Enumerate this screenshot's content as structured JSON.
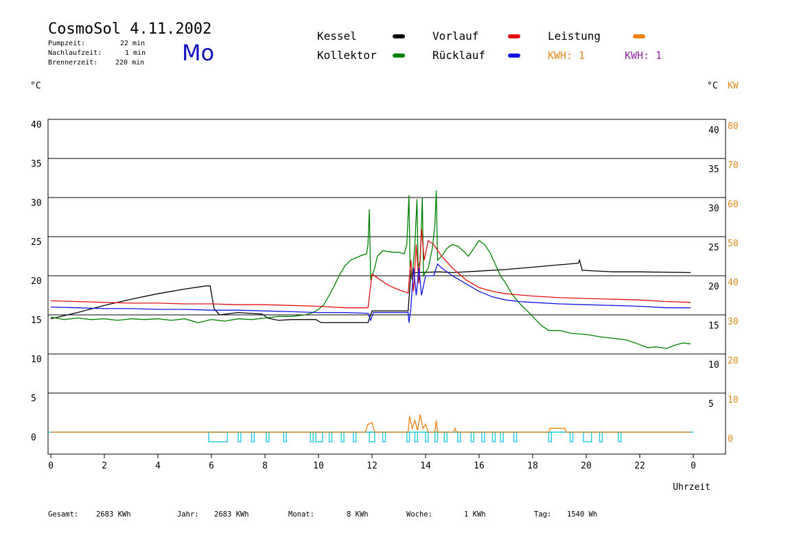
{
  "header": {
    "title": "CosmoSol 4.11.2002",
    "weekday": "Mo",
    "meta": [
      {
        "label": "Pumpzeit:",
        "value": "22 min"
      },
      {
        "label": "Nachlaufzeit:",
        "value": "1 min"
      },
      {
        "label": "Brennerzeit:",
        "value": "220 min"
      }
    ]
  },
  "legend": {
    "items": [
      {
        "name": "Kessel",
        "color": "#000000"
      },
      {
        "name": "Kollektor",
        "color": "#008000"
      },
      {
        "name": "Vorlauf",
        "color": "#e01010"
      },
      {
        "name": "Rücklauf",
        "color": "#1010e0"
      },
      {
        "name": "Leistung",
        "color": "#f08010"
      }
    ],
    "kwh": [
      {
        "text": "KWH: 1",
        "color": "#e08a20"
      },
      {
        "text": "KWH: 1",
        "color": "#8a2a9a"
      }
    ]
  },
  "axes": {
    "left_unit": "°C",
    "right_unit": "°C",
    "right_unit2": "KW",
    "kw_color": "#e08a20",
    "xlabel": "Uhrzeit"
  },
  "footer": [
    {
      "label": "Gesamt:",
      "value": "2683 KWh"
    },
    {
      "label": "Jahr:",
      "value": "2683 KWh"
    },
    {
      "label": "Monat:",
      "value": "8 KWh"
    },
    {
      "label": "Woche:",
      "value": "1 KWh"
    },
    {
      "label": "Tag:",
      "value": "1540 Wh"
    }
  ],
  "chart_data": {
    "type": "line",
    "xlabel": "Uhrzeit",
    "ylabel": "°C",
    "y2label": "KW",
    "xlim": [
      0,
      24
    ],
    "ylim": [
      0,
      40
    ],
    "y2lim": [
      0,
      80
    ],
    "grid": true,
    "x_ticks": [
      "0",
      "2",
      "4",
      "6",
      "8",
      "10",
      "12",
      "14",
      "16",
      "18",
      "20",
      "22",
      "0"
    ],
    "y_ticks": [
      "0",
      "5",
      "10",
      "15",
      "20",
      "25",
      "30",
      "35",
      "40"
    ],
    "y2_ticks": [
      "0",
      "10",
      "20",
      "30",
      "40",
      "50",
      "60",
      "70",
      "80"
    ],
    "series": [
      {
        "name": "Kessel",
        "color": "#000000",
        "points": [
          [
            0,
            14.5
          ],
          [
            1,
            15.3
          ],
          [
            2,
            16.2
          ],
          [
            3,
            17.0
          ],
          [
            4,
            17.7
          ],
          [
            5,
            18.3
          ],
          [
            5.8,
            18.7
          ],
          [
            5.95,
            18.7
          ],
          [
            6.1,
            15.8
          ],
          [
            6.3,
            15.0
          ],
          [
            7,
            15.3
          ],
          [
            7.9,
            15.1
          ],
          [
            8.1,
            14.6
          ],
          [
            8.5,
            14.3
          ],
          [
            9,
            14.4
          ],
          [
            9.9,
            14.4
          ],
          [
            10.1,
            14.0
          ],
          [
            11,
            14.0
          ],
          [
            11.85,
            14.0
          ],
          [
            12,
            15.5
          ],
          [
            12.3,
            15.5
          ],
          [
            13.35,
            15.5
          ],
          [
            13.45,
            20.3
          ],
          [
            13.7,
            20.4
          ],
          [
            14.5,
            20.5
          ],
          [
            15,
            20.4
          ],
          [
            16,
            20.6
          ],
          [
            17,
            20.8
          ],
          [
            18,
            21.1
          ],
          [
            19,
            21.4
          ],
          [
            19.7,
            21.6
          ],
          [
            19.75,
            22.0
          ],
          [
            19.85,
            20.7
          ],
          [
            21,
            20.5
          ],
          [
            22,
            20.5
          ],
          [
            23.9,
            20.4
          ]
        ]
      },
      {
        "name": "Kollektor",
        "color": "#008000",
        "points": [
          [
            0,
            14.7
          ],
          [
            0.5,
            14.4
          ],
          [
            1,
            14.6
          ],
          [
            1.5,
            14.4
          ],
          [
            2,
            14.5
          ],
          [
            2.5,
            14.3
          ],
          [
            3,
            14.5
          ],
          [
            3.5,
            14.4
          ],
          [
            4,
            14.5
          ],
          [
            4.5,
            14.3
          ],
          [
            5,
            14.5
          ],
          [
            5.5,
            14.0
          ],
          [
            6,
            14.4
          ],
          [
            6.5,
            14.2
          ],
          [
            7,
            14.5
          ],
          [
            7.5,
            14.4
          ],
          [
            8,
            14.6
          ],
          [
            8.5,
            14.8
          ],
          [
            9,
            14.8
          ],
          [
            9.5,
            15.0
          ],
          [
            9.8,
            15.3
          ],
          [
            10,
            15.7
          ],
          [
            10.2,
            16.3
          ],
          [
            10.4,
            17.5
          ],
          [
            10.6,
            18.8
          ],
          [
            10.8,
            20.2
          ],
          [
            11,
            21.3
          ],
          [
            11.2,
            22.0
          ],
          [
            11.4,
            22.3
          ],
          [
            11.6,
            22.6
          ],
          [
            11.8,
            22.8
          ],
          [
            11.85,
            24.0
          ],
          [
            11.9,
            28.5
          ],
          [
            11.95,
            19.5
          ],
          [
            12.1,
            21.0
          ],
          [
            12.2,
            22.5
          ],
          [
            12.4,
            23.2
          ],
          [
            12.6,
            23.1
          ],
          [
            12.8,
            23.0
          ],
          [
            13,
            23.0
          ],
          [
            13.2,
            22.8
          ],
          [
            13.3,
            24.0
          ],
          [
            13.38,
            30.3
          ],
          [
            13.42,
            21.0
          ],
          [
            13.5,
            19.5
          ],
          [
            13.6,
            24.0
          ],
          [
            13.68,
            29.8
          ],
          [
            13.72,
            21.0
          ],
          [
            13.8,
            22.0
          ],
          [
            13.88,
            30.0
          ],
          [
            13.92,
            20.0
          ],
          [
            14.1,
            21.0
          ],
          [
            14.25,
            23.5
          ],
          [
            14.35,
            26.5
          ],
          [
            14.4,
            30.9
          ],
          [
            14.45,
            22.0
          ],
          [
            14.6,
            22.5
          ],
          [
            14.8,
            23.5
          ],
          [
            15,
            24.0
          ],
          [
            15.2,
            23.8
          ],
          [
            15.4,
            23.2
          ],
          [
            15.6,
            22.5
          ],
          [
            15.8,
            23.5
          ],
          [
            16,
            24.5
          ],
          [
            16.2,
            24.0
          ],
          [
            16.4,
            23.0
          ],
          [
            16.6,
            21.5
          ],
          [
            16.8,
            20.0
          ],
          [
            17,
            19.0
          ],
          [
            17.2,
            17.8
          ],
          [
            17.5,
            16.5
          ],
          [
            17.8,
            15.5
          ],
          [
            18,
            14.8
          ],
          [
            18.3,
            13.7
          ],
          [
            18.6,
            13.0
          ],
          [
            19,
            13.0
          ],
          [
            19.5,
            12.6
          ],
          [
            20,
            12.5
          ],
          [
            20.5,
            12.2
          ],
          [
            21,
            12.0
          ],
          [
            21.5,
            11.8
          ],
          [
            22,
            11.2
          ],
          [
            22.3,
            10.8
          ],
          [
            22.6,
            10.9
          ],
          [
            23,
            10.7
          ],
          [
            23.3,
            11.1
          ],
          [
            23.6,
            11.4
          ],
          [
            23.9,
            11.3
          ]
        ]
      },
      {
        "name": "Vorlauf",
        "color": "#e01010",
        "points": [
          [
            0,
            16.8
          ],
          [
            1,
            16.7
          ],
          [
            2,
            16.6
          ],
          [
            3,
            16.5
          ],
          [
            4,
            16.5
          ],
          [
            5,
            16.4
          ],
          [
            6,
            16.4
          ],
          [
            7,
            16.3
          ],
          [
            8,
            16.3
          ],
          [
            9,
            16.2
          ],
          [
            10,
            16.1
          ],
          [
            11,
            15.9
          ],
          [
            11.85,
            15.9
          ],
          [
            12,
            20.2
          ],
          [
            12.3,
            19.5
          ],
          [
            12.6,
            18.8
          ],
          [
            13,
            18.2
          ],
          [
            13.35,
            17.8
          ],
          [
            13.45,
            22.0
          ],
          [
            13.55,
            18.0
          ],
          [
            13.65,
            24.0
          ],
          [
            13.75,
            19.0
          ],
          [
            13.85,
            26.0
          ],
          [
            13.95,
            22.0
          ],
          [
            14.1,
            24.5
          ],
          [
            14.3,
            24.0
          ],
          [
            14.6,
            22.5
          ],
          [
            15,
            21.0
          ],
          [
            15.5,
            19.5
          ],
          [
            16,
            18.5
          ],
          [
            16.5,
            18.0
          ],
          [
            17,
            17.7
          ],
          [
            18,
            17.4
          ],
          [
            19,
            17.2
          ],
          [
            20,
            17.1
          ],
          [
            21,
            17.0
          ],
          [
            22,
            16.9
          ],
          [
            23,
            16.7
          ],
          [
            23.9,
            16.6
          ]
        ]
      },
      {
        "name": "Rücklauf",
        "color": "#1010e0",
        "points": [
          [
            0,
            16.0
          ],
          [
            1,
            15.9
          ],
          [
            2,
            15.8
          ],
          [
            3,
            15.8
          ],
          [
            4,
            15.7
          ],
          [
            5,
            15.7
          ],
          [
            6,
            15.6
          ],
          [
            7,
            15.6
          ],
          [
            8,
            15.5
          ],
          [
            9,
            15.4
          ],
          [
            10,
            15.3
          ],
          [
            11,
            15.3
          ],
          [
            11.85,
            15.2
          ],
          [
            11.95,
            14.3
          ],
          [
            12.05,
            15.3
          ],
          [
            13,
            15.3
          ],
          [
            13.35,
            15.3
          ],
          [
            13.38,
            14.0
          ],
          [
            13.45,
            15.8
          ],
          [
            13.55,
            21.0
          ],
          [
            13.65,
            17.5
          ],
          [
            13.75,
            21.0
          ],
          [
            13.85,
            17.5
          ],
          [
            14,
            20.0
          ],
          [
            14.3,
            20.0
          ],
          [
            14.45,
            21.5
          ],
          [
            14.6,
            21.0
          ],
          [
            15,
            20.0
          ],
          [
            15.5,
            19.0
          ],
          [
            16,
            18.0
          ],
          [
            16.5,
            17.3
          ],
          [
            17,
            16.9
          ],
          [
            17.5,
            16.7
          ],
          [
            18,
            16.6
          ],
          [
            19,
            16.4
          ],
          [
            20,
            16.3
          ],
          [
            21,
            16.2
          ],
          [
            22,
            16.1
          ],
          [
            23,
            15.9
          ],
          [
            23.9,
            15.9
          ]
        ]
      },
      {
        "name": "Leistung",
        "color": "#f08010",
        "axis": "right",
        "points": [
          [
            0,
            0
          ],
          [
            11.75,
            0
          ],
          [
            11.85,
            2
          ],
          [
            12.0,
            2.5
          ],
          [
            12.1,
            0
          ],
          [
            13.35,
            0
          ],
          [
            13.4,
            4
          ],
          [
            13.5,
            1
          ],
          [
            13.6,
            3
          ],
          [
            13.7,
            0.5
          ],
          [
            13.8,
            4.5
          ],
          [
            13.9,
            1
          ],
          [
            14.0,
            2
          ],
          [
            14.1,
            0
          ],
          [
            14.35,
            0
          ],
          [
            14.4,
            3
          ],
          [
            14.45,
            0
          ],
          [
            15.05,
            0
          ],
          [
            15.1,
            1
          ],
          [
            15.15,
            0
          ],
          [
            18.6,
            0
          ],
          [
            18.65,
            1
          ],
          [
            19.2,
            1
          ],
          [
            19.25,
            0
          ],
          [
            23.9,
            0
          ]
        ]
      }
    ],
    "pump_intervals": [
      [
        5.9,
        6.6
      ],
      [
        7.0,
        7.1
      ],
      [
        7.5,
        7.6
      ],
      [
        8.05,
        8.15
      ],
      [
        8.7,
        8.8
      ],
      [
        9.7,
        9.8
      ],
      [
        9.9,
        10.15
      ],
      [
        10.4,
        10.5
      ],
      [
        10.85,
        10.95
      ],
      [
        11.3,
        11.4
      ],
      [
        11.9,
        12.1
      ],
      [
        12.4,
        12.5
      ],
      [
        13.3,
        13.4
      ],
      [
        13.6,
        13.7
      ],
      [
        14.0,
        14.1
      ],
      [
        14.35,
        14.45
      ],
      [
        14.7,
        14.8
      ],
      [
        15.2,
        15.3
      ],
      [
        15.7,
        15.8
      ],
      [
        16.1,
        16.2
      ],
      [
        16.5,
        16.6
      ],
      [
        16.8,
        16.9
      ],
      [
        17.3,
        17.4
      ],
      [
        18.6,
        18.7
      ],
      [
        19.4,
        19.5
      ],
      [
        19.9,
        20.2
      ],
      [
        20.5,
        20.6
      ],
      [
        21.2,
        21.3
      ]
    ]
  }
}
